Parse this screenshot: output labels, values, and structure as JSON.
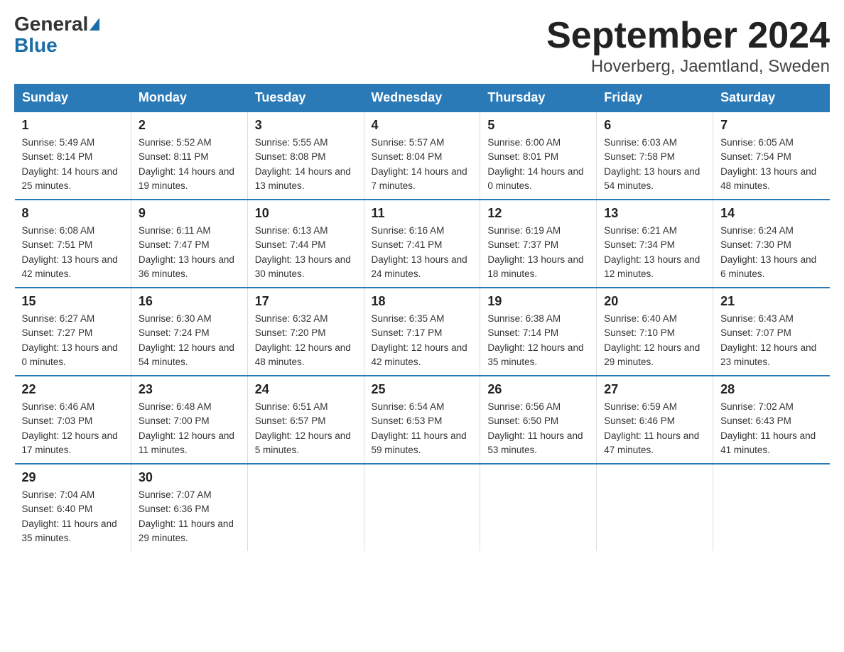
{
  "logo": {
    "general": "General",
    "blue": "Blue",
    "triangle": "▶"
  },
  "title": "September 2024",
  "subtitle": "Hoverberg, Jaemtland, Sweden",
  "weekdays": [
    "Sunday",
    "Monday",
    "Tuesday",
    "Wednesday",
    "Thursday",
    "Friday",
    "Saturday"
  ],
  "weeks": [
    [
      {
        "day": "1",
        "sunrise": "5:49 AM",
        "sunset": "8:14 PM",
        "daylight": "14 hours and 25 minutes."
      },
      {
        "day": "2",
        "sunrise": "5:52 AM",
        "sunset": "8:11 PM",
        "daylight": "14 hours and 19 minutes."
      },
      {
        "day": "3",
        "sunrise": "5:55 AM",
        "sunset": "8:08 PM",
        "daylight": "14 hours and 13 minutes."
      },
      {
        "day": "4",
        "sunrise": "5:57 AM",
        "sunset": "8:04 PM",
        "daylight": "14 hours and 7 minutes."
      },
      {
        "day": "5",
        "sunrise": "6:00 AM",
        "sunset": "8:01 PM",
        "daylight": "14 hours and 0 minutes."
      },
      {
        "day": "6",
        "sunrise": "6:03 AM",
        "sunset": "7:58 PM",
        "daylight": "13 hours and 54 minutes."
      },
      {
        "day": "7",
        "sunrise": "6:05 AM",
        "sunset": "7:54 PM",
        "daylight": "13 hours and 48 minutes."
      }
    ],
    [
      {
        "day": "8",
        "sunrise": "6:08 AM",
        "sunset": "7:51 PM",
        "daylight": "13 hours and 42 minutes."
      },
      {
        "day": "9",
        "sunrise": "6:11 AM",
        "sunset": "7:47 PM",
        "daylight": "13 hours and 36 minutes."
      },
      {
        "day": "10",
        "sunrise": "6:13 AM",
        "sunset": "7:44 PM",
        "daylight": "13 hours and 30 minutes."
      },
      {
        "day": "11",
        "sunrise": "6:16 AM",
        "sunset": "7:41 PM",
        "daylight": "13 hours and 24 minutes."
      },
      {
        "day": "12",
        "sunrise": "6:19 AM",
        "sunset": "7:37 PM",
        "daylight": "13 hours and 18 minutes."
      },
      {
        "day": "13",
        "sunrise": "6:21 AM",
        "sunset": "7:34 PM",
        "daylight": "13 hours and 12 minutes."
      },
      {
        "day": "14",
        "sunrise": "6:24 AM",
        "sunset": "7:30 PM",
        "daylight": "13 hours and 6 minutes."
      }
    ],
    [
      {
        "day": "15",
        "sunrise": "6:27 AM",
        "sunset": "7:27 PM",
        "daylight": "13 hours and 0 minutes."
      },
      {
        "day": "16",
        "sunrise": "6:30 AM",
        "sunset": "7:24 PM",
        "daylight": "12 hours and 54 minutes."
      },
      {
        "day": "17",
        "sunrise": "6:32 AM",
        "sunset": "7:20 PM",
        "daylight": "12 hours and 48 minutes."
      },
      {
        "day": "18",
        "sunrise": "6:35 AM",
        "sunset": "7:17 PM",
        "daylight": "12 hours and 42 minutes."
      },
      {
        "day": "19",
        "sunrise": "6:38 AM",
        "sunset": "7:14 PM",
        "daylight": "12 hours and 35 minutes."
      },
      {
        "day": "20",
        "sunrise": "6:40 AM",
        "sunset": "7:10 PM",
        "daylight": "12 hours and 29 minutes."
      },
      {
        "day": "21",
        "sunrise": "6:43 AM",
        "sunset": "7:07 PM",
        "daylight": "12 hours and 23 minutes."
      }
    ],
    [
      {
        "day": "22",
        "sunrise": "6:46 AM",
        "sunset": "7:03 PM",
        "daylight": "12 hours and 17 minutes."
      },
      {
        "day": "23",
        "sunrise": "6:48 AM",
        "sunset": "7:00 PM",
        "daylight": "12 hours and 11 minutes."
      },
      {
        "day": "24",
        "sunrise": "6:51 AM",
        "sunset": "6:57 PM",
        "daylight": "12 hours and 5 minutes."
      },
      {
        "day": "25",
        "sunrise": "6:54 AM",
        "sunset": "6:53 PM",
        "daylight": "11 hours and 59 minutes."
      },
      {
        "day": "26",
        "sunrise": "6:56 AM",
        "sunset": "6:50 PM",
        "daylight": "11 hours and 53 minutes."
      },
      {
        "day": "27",
        "sunrise": "6:59 AM",
        "sunset": "6:46 PM",
        "daylight": "11 hours and 47 minutes."
      },
      {
        "day": "28",
        "sunrise": "7:02 AM",
        "sunset": "6:43 PM",
        "daylight": "11 hours and 41 minutes."
      }
    ],
    [
      {
        "day": "29",
        "sunrise": "7:04 AM",
        "sunset": "6:40 PM",
        "daylight": "11 hours and 35 minutes."
      },
      {
        "day": "30",
        "sunrise": "7:07 AM",
        "sunset": "6:36 PM",
        "daylight": "11 hours and 29 minutes."
      },
      null,
      null,
      null,
      null,
      null
    ]
  ]
}
